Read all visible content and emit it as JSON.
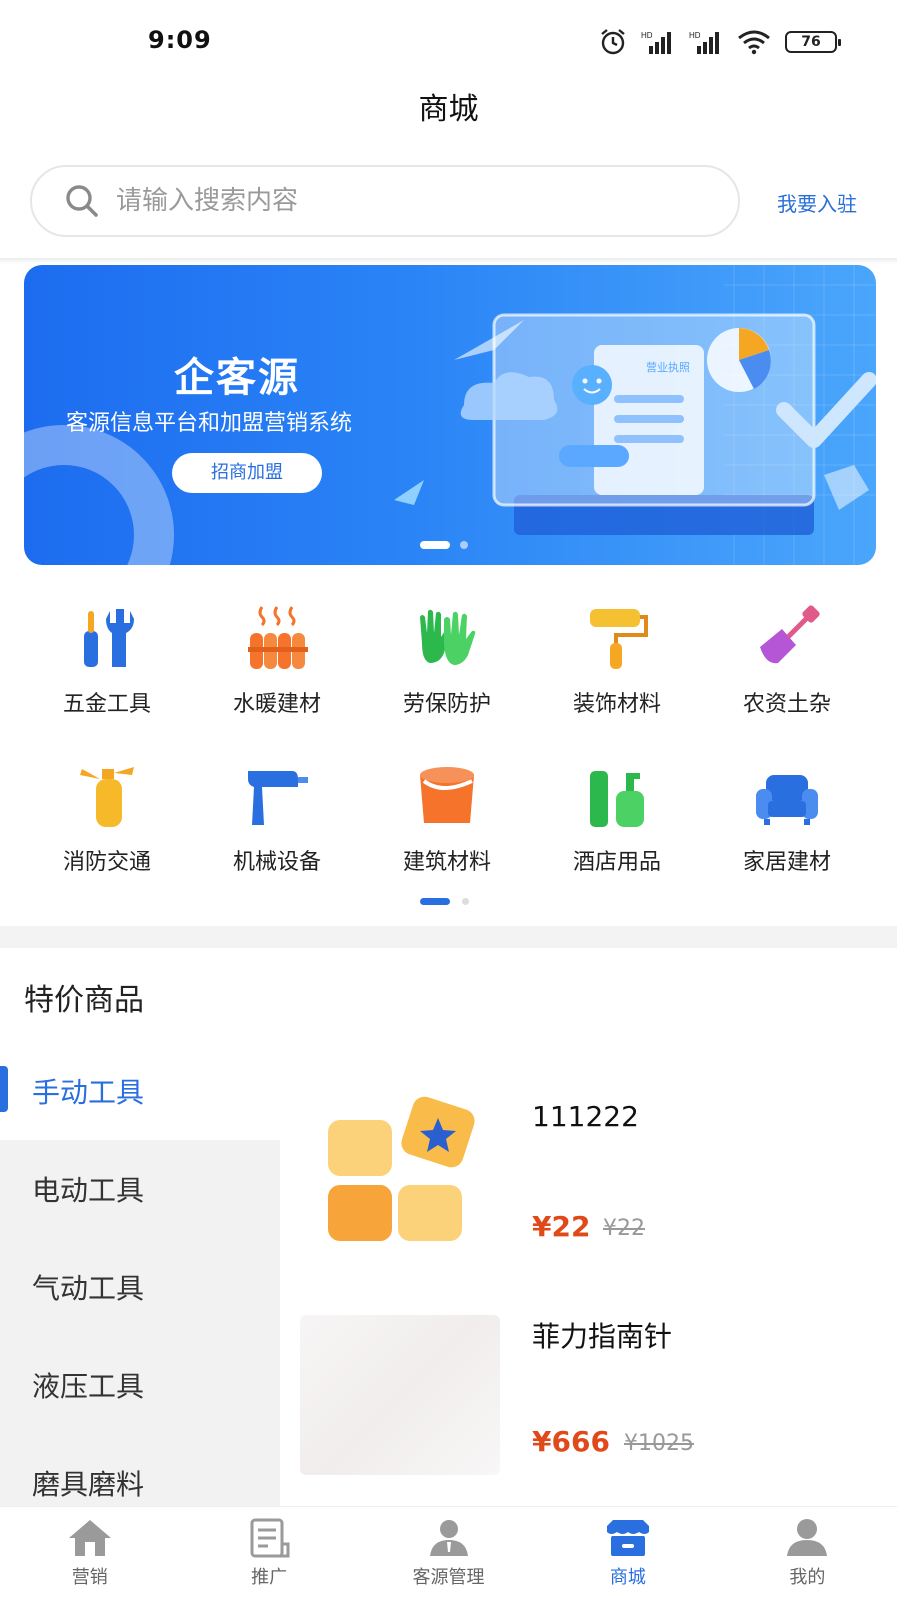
{
  "status_bar": {
    "time": "9:09",
    "battery": "76"
  },
  "header": {
    "title": "商城"
  },
  "search": {
    "placeholder": "请输入搜索内容",
    "join_label": "我要入驻"
  },
  "banner": {
    "title": "企客源",
    "subtitle": "客源信息平台和加盟营销系统",
    "button_label": "招商加盟",
    "illustration_text": "营业执照"
  },
  "categories": [
    {
      "label": "五金工具",
      "icon": "wrench-icon"
    },
    {
      "label": "水暖建材",
      "icon": "radiator-icon"
    },
    {
      "label": "劳保防护",
      "icon": "gloves-icon"
    },
    {
      "label": "装饰材料",
      "icon": "paint-roller-icon"
    },
    {
      "label": "农资土杂",
      "icon": "shovel-icon"
    },
    {
      "label": "消防交通",
      "icon": "fire-extinguisher-icon"
    },
    {
      "label": "机械设备",
      "icon": "drill-icon"
    },
    {
      "label": "建筑材料",
      "icon": "paint-bucket-icon"
    },
    {
      "label": "酒店用品",
      "icon": "bottles-icon"
    },
    {
      "label": "家居建材",
      "icon": "sofa-icon"
    }
  ],
  "special": {
    "title": "特价商品",
    "tabs": [
      "手动工具",
      "电动工具",
      "气动工具",
      "液压工具",
      "磨具磨料"
    ],
    "active_tab": "手动工具",
    "products": [
      {
        "name": "111222",
        "price": "¥22",
        "original_price": "¥22"
      },
      {
        "name": "菲力指南针",
        "price": "¥666",
        "original_price": "¥1025"
      }
    ]
  },
  "bottom_nav": [
    {
      "label": "营销",
      "icon": "home-icon",
      "active": false
    },
    {
      "label": "推广",
      "icon": "document-icon",
      "active": false
    },
    {
      "label": "客源管理",
      "icon": "person-icon",
      "active": false
    },
    {
      "label": "商城",
      "icon": "store-icon",
      "active": true
    },
    {
      "label": "我的",
      "icon": "user-icon",
      "active": false
    }
  ],
  "colors": {
    "accent": "#2a6fe0",
    "price": "#e04a1a"
  }
}
